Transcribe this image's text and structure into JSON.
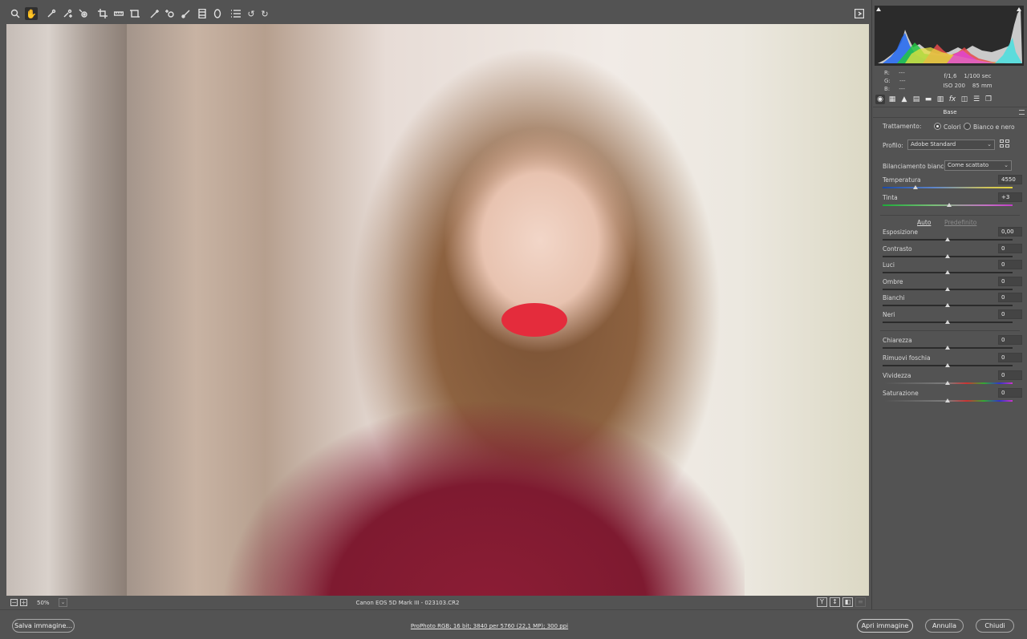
{
  "toolbar": {
    "tools": [
      {
        "name": "zoom-tool",
        "icon": "zoom-icon"
      },
      {
        "name": "hand-tool",
        "icon": "hand-icon",
        "active": true
      },
      {
        "name": "white-balance-tool",
        "icon": "eyedropper-icon"
      },
      {
        "name": "color-sampler-tool",
        "icon": "color-sampler-icon"
      },
      {
        "name": "targeted-adjustment-tool",
        "icon": "target-icon"
      },
      {
        "name": "crop-tool",
        "icon": "crop-icon"
      },
      {
        "name": "straighten-tool",
        "icon": "ruler-icon"
      },
      {
        "name": "transform-tool",
        "icon": "transform-icon"
      },
      {
        "name": "spot-removal-tool",
        "icon": "brush-heal-icon"
      },
      {
        "name": "red-eye-tool",
        "icon": "red-eye-icon"
      },
      {
        "name": "adjustment-brush-tool",
        "icon": "brush-icon"
      },
      {
        "name": "graduated-filter-tool",
        "icon": "graduated-filter-icon"
      },
      {
        "name": "radial-filter-tool",
        "icon": "radial-filter-icon"
      },
      {
        "name": "preferences-tool",
        "icon": "list-icon"
      },
      {
        "name": "rotate-left-tool",
        "icon": "rotate-left-icon"
      },
      {
        "name": "rotate-right-tool",
        "icon": "rotate-right-icon"
      }
    ],
    "fullscreen_icon": "fullscreen-icon"
  },
  "preview_footer": {
    "zoom": "50%",
    "camera_info": "Canon EOS 5D Mark III  -  023103.CR2",
    "view_buttons": [
      "Y",
      "↕",
      "◧"
    ]
  },
  "bottom": {
    "save_label": "Salva immagine...",
    "workflow_link": "ProPhoto RGB; 16 bit; 3840 per 5760 (22,1 MP); 300 ppi",
    "open_label": "Apri immagine",
    "cancel_label": "Annulla",
    "close_label": "Chiudi"
  },
  "readout": {
    "r_label": "R:",
    "r_value": "---",
    "g_label": "G:",
    "g_value": "---",
    "b_label": "B:",
    "b_value": "---",
    "aperture": "f/1,6",
    "shutter": "1/100 sec",
    "iso": "ISO 200",
    "focal": "85 mm"
  },
  "panel": {
    "title": "Base",
    "trattamento_label": "Trattamento:",
    "colori_label": "Colori",
    "bianco_nero_label": "Bianco e nero",
    "profilo_label": "Profilo:",
    "profilo_value": "Adobe Standard",
    "wb_label": "Bilanciamento bianco:",
    "wb_value": "Come scattato",
    "auto_label": "Auto",
    "default_label": "Predefinito",
    "sliders": [
      {
        "label": "Temperatura",
        "value": "4550",
        "pos": 0.25
      },
      {
        "label": "Tinta",
        "value": "+3",
        "pos": 0.51
      },
      {
        "label": "Esposizione",
        "value": "0,00",
        "pos": 0.5
      },
      {
        "label": "Contrasto",
        "value": "0",
        "pos": 0.5
      },
      {
        "label": "Luci",
        "value": "0",
        "pos": 0.5
      },
      {
        "label": "Ombre",
        "value": "0",
        "pos": 0.5
      },
      {
        "label": "Bianchi",
        "value": "0",
        "pos": 0.5
      },
      {
        "label": "Neri",
        "value": "0",
        "pos": 0.5
      },
      {
        "label": "Chiarezza",
        "value": "0",
        "pos": 0.5
      },
      {
        "label": "Rimuovi foschia",
        "value": "0",
        "pos": 0.5
      },
      {
        "label": "Vividezza",
        "value": "0",
        "pos": 0.5
      },
      {
        "label": "Saturazione",
        "value": "0",
        "pos": 0.5
      }
    ]
  },
  "colors": {
    "background": "#535353",
    "histogram_bg": "#2b2b2b",
    "lips": "#e42c3c",
    "sweater": "#8c1d35"
  }
}
